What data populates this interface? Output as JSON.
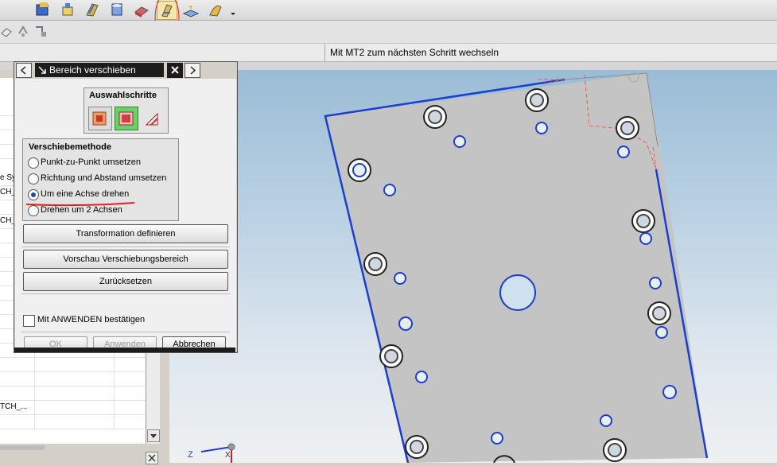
{
  "cue_line": "Mit MT2 zum nächsten Schritt wechseln",
  "dialog": {
    "title": "Bereich verschieben",
    "selection_steps_title": "Auswahlschritte",
    "move_method_title": "Verschiebemethode",
    "options": [
      {
        "label": "Punkt-zu-Punkt umsetzen",
        "selected": false
      },
      {
        "label": "Richtung und Abstand umsetzen",
        "selected": false
      },
      {
        "label": "Um eine Achse drehen",
        "selected": true
      },
      {
        "label": "Drehen um 2 Achsen",
        "selected": false
      }
    ],
    "buttons": {
      "define_transform": "Transformation definieren",
      "preview": "Vorschau Verschiebungsbereich",
      "reset": "Zurücksetzen",
      "ok": "OK",
      "apply": "Anwenden",
      "cancel": "Abbrechen"
    },
    "confirm_checkbox": "Mit ANWENDEN bestätigen",
    "confirm_checked": false
  },
  "navigator": {
    "cells": [
      "e Sy",
      "CH_",
      "CH_",
      "TCH_..."
    ]
  },
  "axis_labels": {
    "z": "Z",
    "x": "X"
  },
  "colors": {
    "accent_blue": "#1a3fcf",
    "annotation_red": "#e02020",
    "part_gray": "#c4c4c4"
  }
}
